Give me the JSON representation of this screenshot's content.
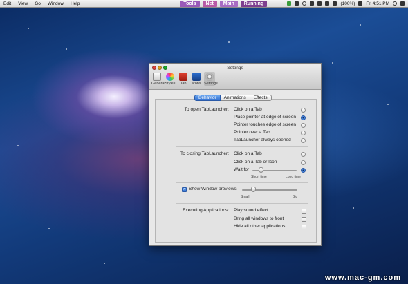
{
  "menubar": {
    "items": [
      "Edit",
      "View",
      "Go",
      "Window",
      "Help"
    ],
    "tags": [
      "Tools",
      "Net",
      "Main",
      "Running"
    ],
    "battery": "(100%)",
    "clock": "Fri 4:51 PM"
  },
  "window": {
    "title": "Settings",
    "toolbar": [
      "General",
      "Styles",
      "Tab",
      "Icons",
      "Settings"
    ],
    "tabs": [
      "Behavior",
      "Animations",
      "Effects"
    ],
    "open_section": {
      "label": "To open TabLauncher:",
      "options": [
        "Click on a Tab",
        "Place pointer at edge of screen",
        "Pointer touches edge of screen",
        "Pointer over a Tab",
        "TabLauncher always opened"
      ],
      "selected_index": 1
    },
    "close_section": {
      "label": "To closing TabLauncher:",
      "options": [
        "Click on a Tab",
        "Click on a Tab or Icon",
        "Wait for"
      ],
      "selected_index": 2,
      "wait_min": "Short time",
      "wait_max": "Long time",
      "wait_value": 0.2
    },
    "preview": {
      "label": "Show Window previews:",
      "checked": true,
      "min": "Small",
      "max": "Big",
      "value": 0.2
    },
    "exec_section": {
      "label": "Executing Applications:",
      "options": [
        "Play sound effect",
        "Bring all windows to front",
        "Hide all other applications"
      ],
      "checked": [
        false,
        false,
        false
      ]
    }
  },
  "watermark": "www.mac-gm.com"
}
